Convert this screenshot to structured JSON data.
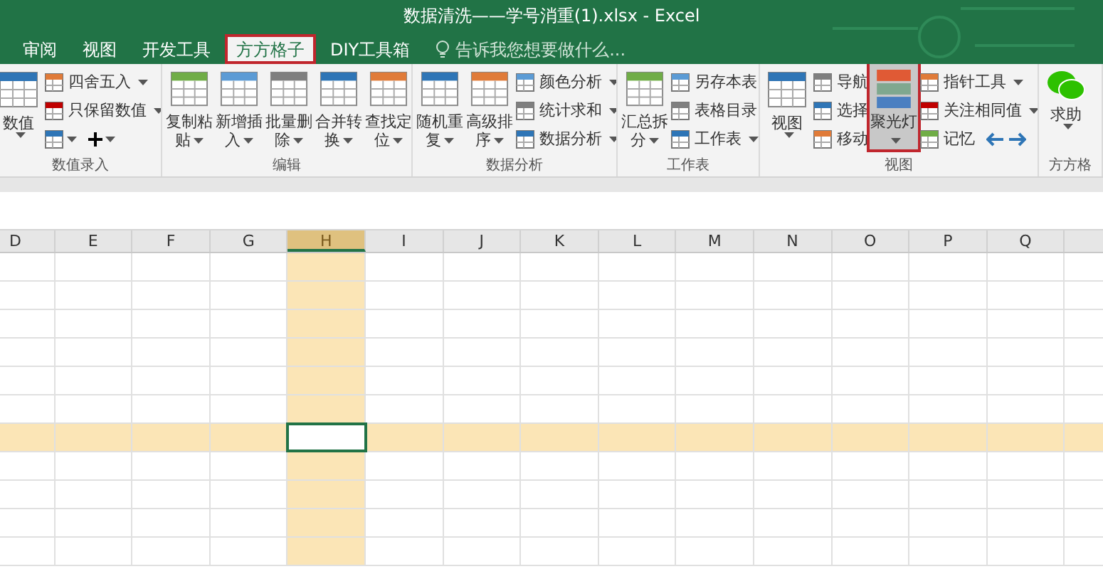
{
  "window": {
    "title": "数据清洗——学号消重(1).xlsx - Excel"
  },
  "tabs": [
    {
      "label": "审阅",
      "selected": false
    },
    {
      "label": "视图",
      "selected": false
    },
    {
      "label": "开发工具",
      "selected": false
    },
    {
      "label": "方方格子",
      "selected": true
    },
    {
      "label": "DIY工具箱",
      "selected": false
    }
  ],
  "search": {
    "placeholder": "告诉我您想要做什么..."
  },
  "groups": [
    {
      "label": "数值录入",
      "columns": [
        {
          "kind": "large",
          "label": "数值",
          "dropdown": true,
          "selected": false
        },
        {
          "kind": "stack",
          "items": [
            {
              "label": "四舍五入",
              "dropdown": true
            },
            {
              "label": "只保留数值",
              "dropdown": true
            },
            {
              "kind": "pair",
              "dropdown": true
            }
          ]
        }
      ]
    },
    {
      "label": "编辑",
      "columns": [
        {
          "kind": "large",
          "label": "复制粘贴",
          "dropdown": true,
          "selected": false
        },
        {
          "kind": "large",
          "label": "新增插入",
          "dropdown": true,
          "selected": false
        },
        {
          "kind": "large",
          "label": "批量删除",
          "dropdown": true,
          "selected": false
        },
        {
          "kind": "large",
          "label": "合并转换",
          "dropdown": true,
          "selected": false
        },
        {
          "kind": "large",
          "label": "查找定位",
          "dropdown": true,
          "selected": false
        }
      ]
    },
    {
      "label": "数据分析",
      "columns": [
        {
          "kind": "large",
          "label": "随机重复",
          "dropdown": true,
          "selected": false
        },
        {
          "kind": "large",
          "label": "高级排序",
          "dropdown": true,
          "selected": false
        },
        {
          "kind": "stack",
          "items": [
            {
              "label": "颜色分析",
              "dropdown": true
            },
            {
              "label": "统计求和",
              "dropdown": true
            },
            {
              "label": "数据分析",
              "dropdown": true
            }
          ]
        }
      ]
    },
    {
      "label": "工作表",
      "columns": [
        {
          "kind": "large",
          "label": "汇总拆分",
          "dropdown": true,
          "selected": false
        },
        {
          "kind": "stack",
          "items": [
            {
              "label": "另存本表",
              "dropdown": false
            },
            {
              "label": "表格目录",
              "dropdown": false
            },
            {
              "label": "工作表",
              "dropdown": true
            }
          ]
        }
      ]
    },
    {
      "label": "视图",
      "columns": [
        {
          "kind": "large",
          "label": "视图",
          "dropdown": true,
          "selected": false
        },
        {
          "kind": "stack",
          "items": [
            {
              "label": "导航",
              "dropdown": false
            },
            {
              "label": "选择",
              "dropdown": false
            },
            {
              "label": "移动",
              "dropdown": false
            }
          ]
        },
        {
          "kind": "large",
          "label": "聚光灯",
          "dropdown": true,
          "selected": true
        },
        {
          "kind": "stack",
          "items": [
            {
              "label": "指针工具",
              "dropdown": true
            },
            {
              "label": "关注相同值",
              "dropdown": true
            },
            {
              "kind": "arrows",
              "label": "记忆",
              "dropdown": false
            }
          ]
        }
      ]
    },
    {
      "label": "方方格",
      "columns": [
        {
          "kind": "large",
          "label": "求助",
          "dropdown": true,
          "selected": false
        }
      ]
    }
  ],
  "grid": {
    "columns": [
      {
        "label": "D",
        "selected": false
      },
      {
        "label": "E",
        "selected": false
      },
      {
        "label": "F",
        "selected": false
      },
      {
        "label": "G",
        "selected": false
      },
      {
        "label": "H",
        "selected": true
      },
      {
        "label": "I",
        "selected": false
      },
      {
        "label": "J",
        "selected": false
      },
      {
        "label": "K",
        "selected": false
      },
      {
        "label": "L",
        "selected": false
      },
      {
        "label": "M",
        "selected": false
      },
      {
        "label": "N",
        "selected": false
      },
      {
        "label": "O",
        "selected": false
      },
      {
        "label": "P",
        "selected": false
      },
      {
        "label": "Q",
        "selected": false
      }
    ],
    "rows": [
      {
        "selected": false
      },
      {
        "selected": false
      },
      {
        "selected": false
      },
      {
        "selected": false
      },
      {
        "selected": false
      },
      {
        "selected": false
      },
      {
        "selected": true
      },
      {
        "selected": false
      },
      {
        "selected": false
      },
      {
        "selected": false
      },
      {
        "selected": false
      }
    ]
  }
}
